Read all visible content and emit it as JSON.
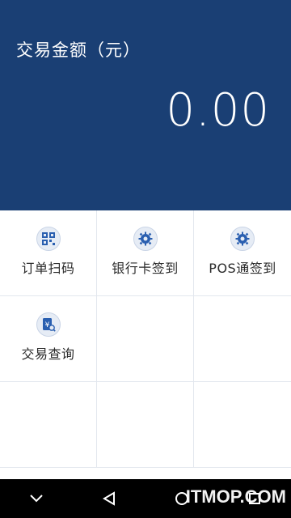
{
  "header": {
    "amount_label": "交易金额（元）",
    "amount_value": "0.00",
    "background": "#1a3f74"
  },
  "menu": {
    "items": [
      {
        "label": "订单扫码",
        "icon": "qr-scan-icon"
      },
      {
        "label": "银行卡签到",
        "icon": "gear-icon"
      },
      {
        "label": "POS通签到",
        "icon": "gear-icon"
      },
      {
        "label": "交易查询",
        "icon": "transaction-search-icon"
      }
    ]
  },
  "navbar": {
    "back_icon": "back-triangle-icon",
    "home_icon": "home-circle-icon",
    "recents_icon": "recents-square-icon",
    "down_icon": "chevron-down-icon"
  },
  "watermark": {
    "text": "ITMOP.COM"
  }
}
